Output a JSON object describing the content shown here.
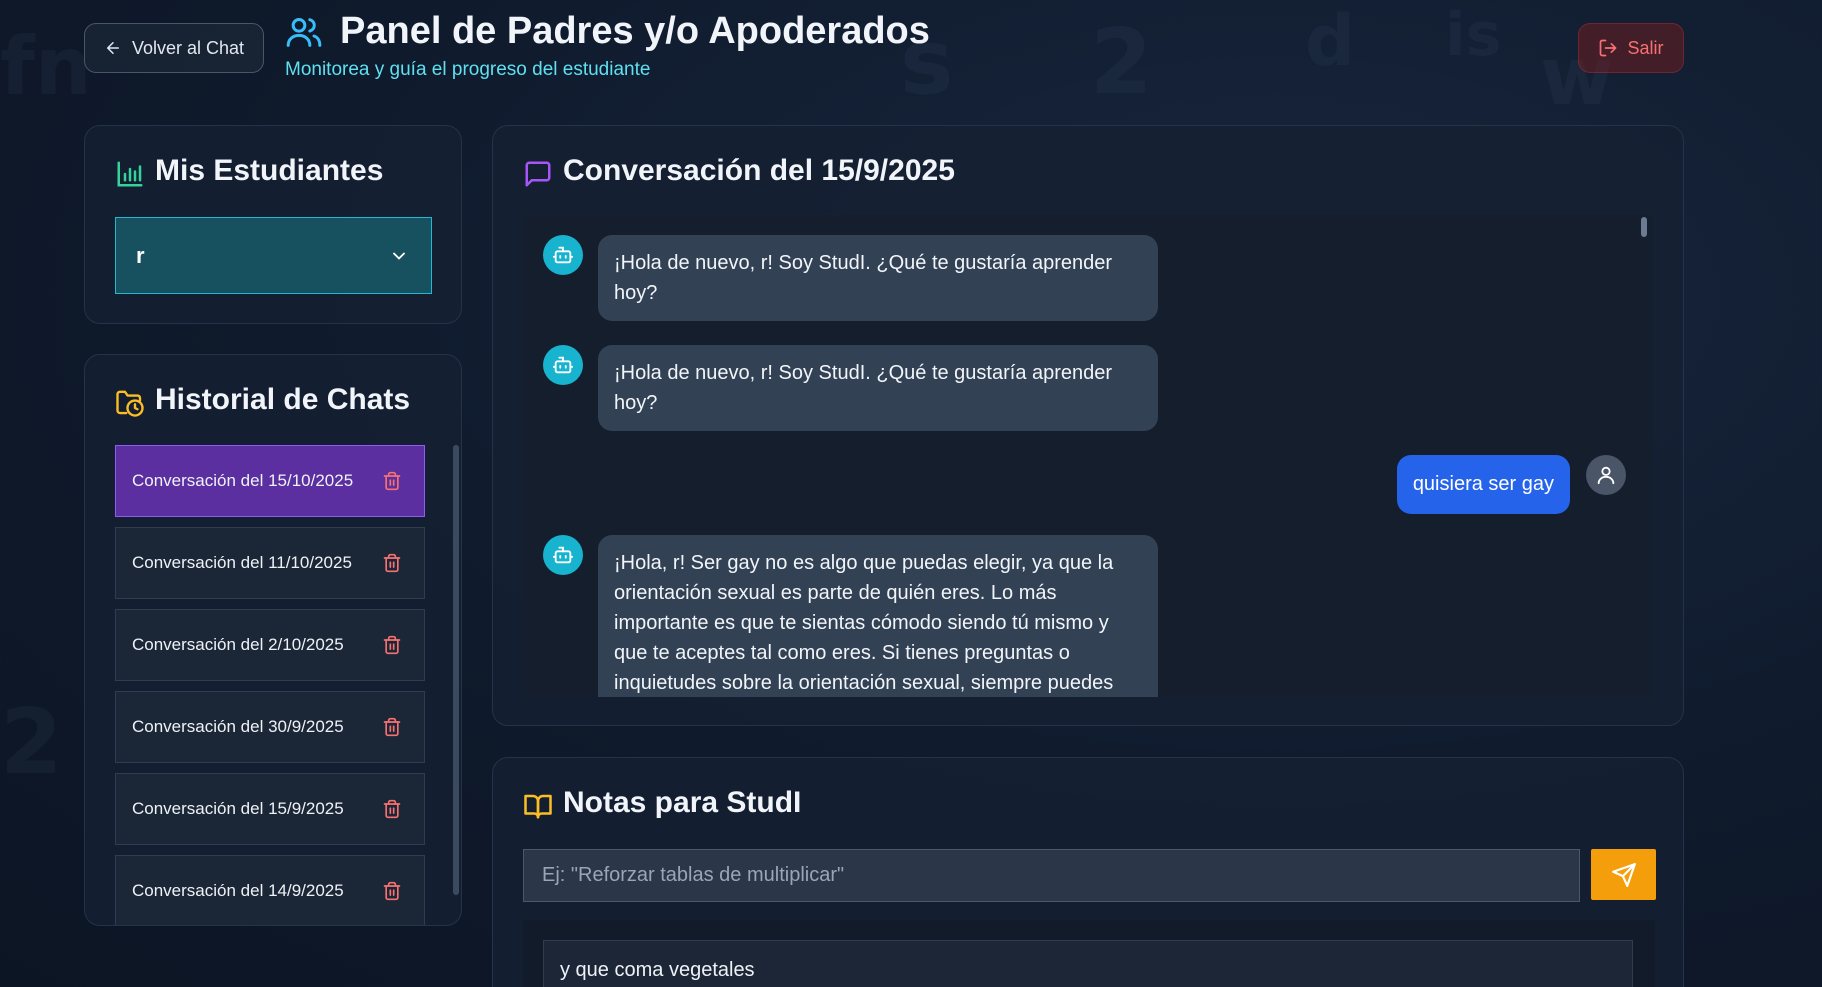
{
  "header": {
    "back_label": "Volver al Chat",
    "title": "Panel de Padres y/o Apoderados",
    "subtitle": "Monitorea y guía el progreso del estudiante",
    "logout_label": "Salir"
  },
  "students": {
    "title": "Mis Estudiantes",
    "selected": "r"
  },
  "history": {
    "title": "Historial de Chats",
    "items": [
      {
        "label": "Conversación del 15/10/2025",
        "active": true
      },
      {
        "label": "Conversación del 11/10/2025",
        "active": false
      },
      {
        "label": "Conversación del 2/10/2025",
        "active": false
      },
      {
        "label": "Conversación del 30/9/2025",
        "active": false
      },
      {
        "label": "Conversación del 15/9/2025",
        "active": false
      },
      {
        "label": "Conversación del 14/9/2025",
        "active": false
      }
    ]
  },
  "chat": {
    "title": "Conversación del 15/9/2025",
    "messages": [
      {
        "role": "bot",
        "text": "¡Hola de nuevo, r! Soy StudI. ¿Qué te gustaría aprender hoy?"
      },
      {
        "role": "bot",
        "text": "¡Hola de nuevo, r! Soy StudI. ¿Qué te gustaría aprender hoy?"
      },
      {
        "role": "user",
        "text": "quisiera ser gay"
      },
      {
        "role": "bot",
        "text": "¡Hola, r! Ser gay no es algo que puedas elegir, ya que la orientación sexual es parte de quién eres. Lo más importante es que te sientas cómodo siendo tú mismo y que te aceptes tal como eres. Si tienes preguntas o inquietudes sobre la orientación sexual, siempre puedes"
      }
    ]
  },
  "notes": {
    "title": "Notas para StudI",
    "placeholder": "Ej: \"Reforzar tablas de multiplicar\"",
    "items": [
      "y que coma vegetales"
    ]
  },
  "colors": {
    "accent_cyan": "#22b8cf",
    "active_purple": "#5b2fa0",
    "user_bubble": "#2563eb",
    "send_button": "#f59e0b",
    "logout_red": "#f87171"
  }
}
